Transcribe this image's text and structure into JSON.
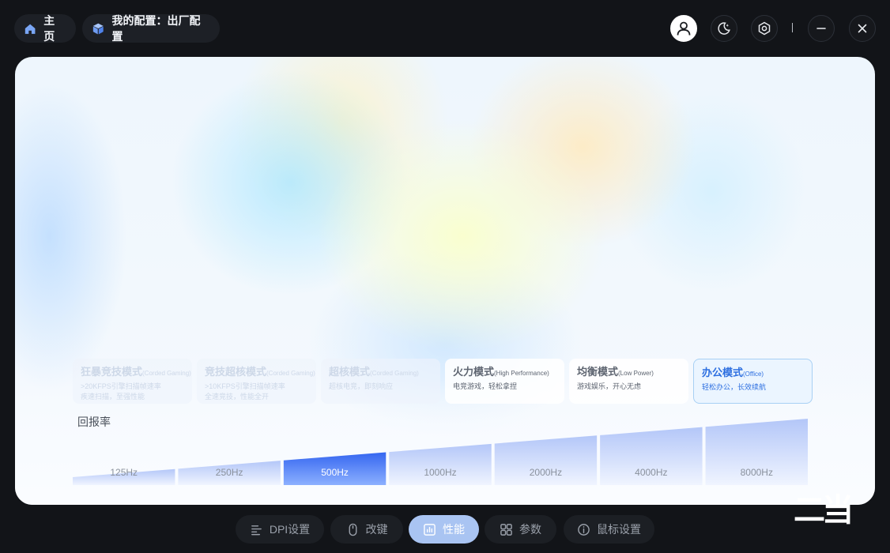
{
  "header": {
    "home_label": "主页",
    "config_label": "我的配置：出厂配置",
    "icons": [
      "home-icon",
      "cube-icon",
      "user-icon",
      "moon-icon",
      "hexagon-settings-icon",
      "minimize-icon",
      "close-icon"
    ],
    "separator": "|"
  },
  "modes": [
    {
      "name": "狂暴竞技模式",
      "en": "(Corded Gaming)",
      "desc": [
        ">20KFPS引擎扫描帧速率",
        "疾速扫描，至强性能"
      ],
      "state": "disabled"
    },
    {
      "name": "竞技超核模式",
      "en": "(Corded Gaming)",
      "desc": [
        ">10KFPS引擎扫描帧速率",
        "全速竞技，性能全开"
      ],
      "state": "disabled"
    },
    {
      "name": "超核模式",
      "en": "(Corded Gaming)",
      "desc": [
        "超核电竞，即刻响应"
      ],
      "state": "disabled"
    },
    {
      "name": "火力模式",
      "en": "(High Performance)",
      "desc": [
        "电竞游戏，轻松拿捏"
      ],
      "state": "normal"
    },
    {
      "name": "均衡模式",
      "en": "(Low Power)",
      "desc": [
        "游戏娱乐，开心无虑"
      ],
      "state": "normal"
    },
    {
      "name": "办公模式",
      "en": "(Office)",
      "desc": [
        "轻松办公，长效续航"
      ],
      "state": "active"
    }
  ],
  "polling": {
    "label": "回报率",
    "options": [
      "125Hz",
      "250Hz",
      "500Hz",
      "1000Hz",
      "2000Hz",
      "4000Hz",
      "8000Hz"
    ],
    "selected": "500Hz"
  },
  "tabs": [
    {
      "label": "DPI设置",
      "icon": "dpi-sliders-icon",
      "active": false
    },
    {
      "label": "改键",
      "icon": "mouse-icon",
      "active": false
    },
    {
      "label": "性能",
      "icon": "performance-chart-icon",
      "active": true
    },
    {
      "label": "参数",
      "icon": "grid-params-icon",
      "active": false
    },
    {
      "label": "鼠标设置",
      "icon": "info-circle-icon",
      "active": false
    }
  ],
  "watermark": "二当",
  "colors": {
    "accent": "#2d6fe0",
    "selected_bar": "#3f6ff0",
    "active_tab": "#a9c4f2",
    "background": "#121418"
  }
}
